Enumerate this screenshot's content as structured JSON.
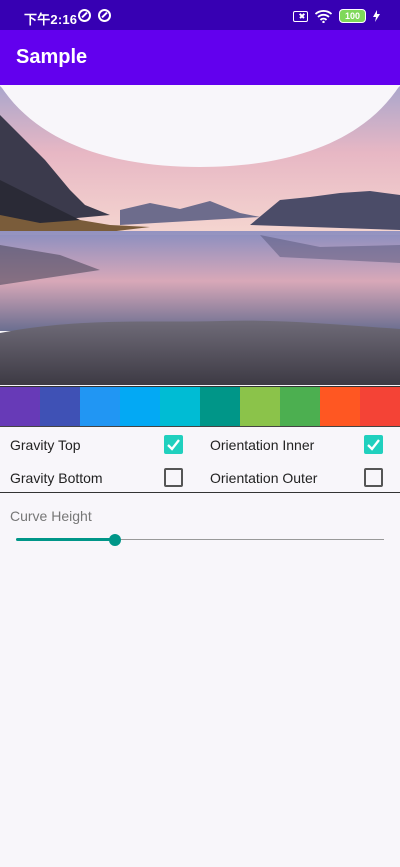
{
  "status_bar": {
    "time": "下午2:16",
    "battery": "100",
    "icons": [
      "notification-circle-icon",
      "notification-circle-icon",
      "sim-off-icon",
      "wifi-icon",
      "battery-icon",
      "charging-icon"
    ]
  },
  "app_bar": {
    "title": "Sample"
  },
  "swatches": [
    "#673ab7",
    "#3f51b5",
    "#2196f3",
    "#03a9f4",
    "#00bcd4",
    "#009688",
    "#8bc34a",
    "#4caf50",
    "#ff5722",
    "#f44336"
  ],
  "options": {
    "gravity_top": {
      "label": "Gravity Top",
      "checked": true
    },
    "gravity_bottom": {
      "label": "Gravity Bottom",
      "checked": false
    },
    "orientation_inner": {
      "label": "Orientation Inner",
      "checked": true
    },
    "orientation_outer": {
      "label": "Orientation Outer",
      "checked": false
    }
  },
  "curve": {
    "label": "Curve Height",
    "value_fraction": 0.27
  },
  "colors": {
    "primary": "#6200ee",
    "primary_dark": "#3700b3",
    "accent": "#20d0be",
    "slider": "#009688"
  }
}
